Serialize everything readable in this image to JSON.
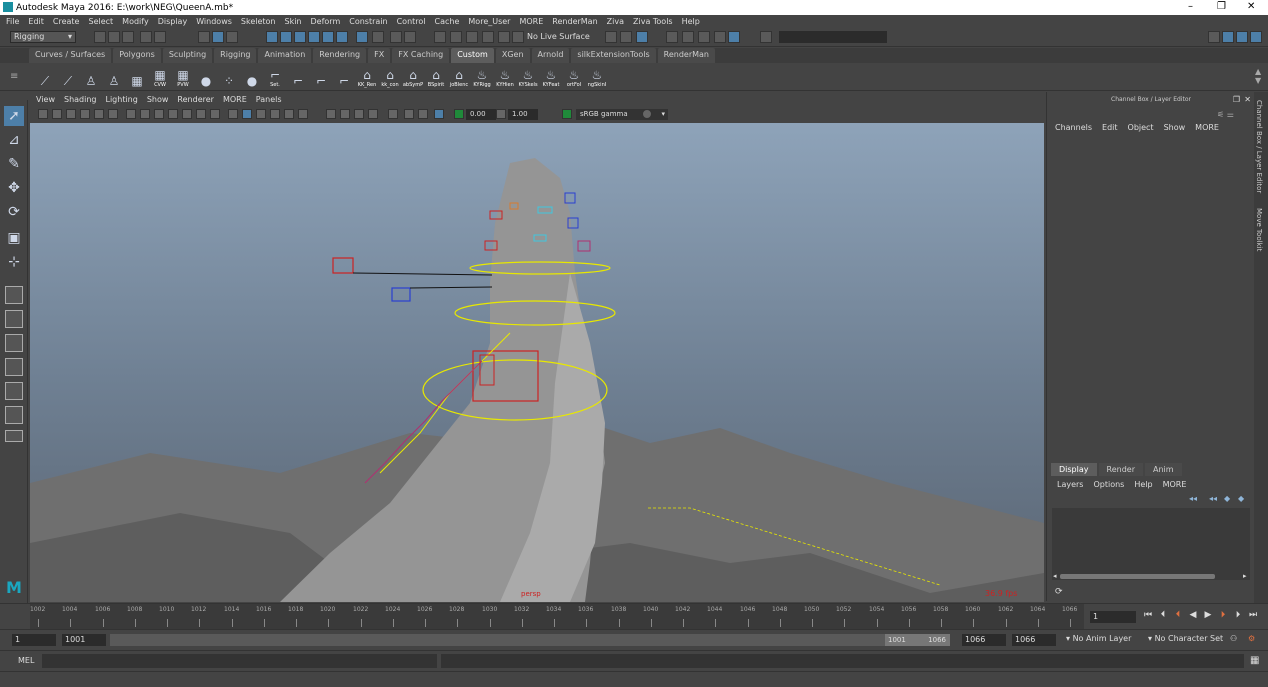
{
  "app": {
    "title": "Autodesk Maya 2016: E:\\work\\NEG\\QueenA.mb*"
  },
  "menu": [
    "File",
    "Edit",
    "Create",
    "Select",
    "Modify",
    "Display",
    "Windows",
    "Skeleton",
    "Skin",
    "Deform",
    "Constrain",
    "Control",
    "Cache",
    "More_User",
    "MORE",
    "RenderMan",
    "Ziva",
    "Ziva Tools",
    "Help"
  ],
  "status": {
    "mode": "Rigging",
    "live_surface": "No Live Surface"
  },
  "shelf_tabs": [
    "Curves / Surfaces",
    "Polygons",
    "Sculpting",
    "Rigging",
    "Animation",
    "Rendering",
    "FX",
    "FX Caching",
    "Custom",
    "XGen",
    "Arnold",
    "silkExtensionTools",
    "RenderMan"
  ],
  "shelf_active": "Custom",
  "shelf_buttons": [
    {
      "icon": "curve-icon",
      "label": ""
    },
    {
      "icon": "curve-icon",
      "label": ""
    },
    {
      "icon": "figure-icon",
      "label": ""
    },
    {
      "icon": "figure-icon",
      "label": ""
    },
    {
      "icon": "grid-icon",
      "label": ""
    },
    {
      "icon": "grid-icon",
      "label": "CVW"
    },
    {
      "icon": "grid-icon",
      "label": "PVW"
    },
    {
      "icon": "sphere-icon",
      "label": ""
    },
    {
      "icon": "dots-icon",
      "label": ""
    },
    {
      "icon": "sphere-icon",
      "label": ""
    },
    {
      "icon": "joint-icon",
      "label": "Set."
    },
    {
      "icon": "joint-icon",
      "label": ""
    },
    {
      "icon": "joint-icon",
      "label": ""
    },
    {
      "icon": "joint-icon",
      "label": ""
    },
    {
      "icon": "house-icon",
      "label": "KK_Ren"
    },
    {
      "icon": "house-icon",
      "label": "kk_con"
    },
    {
      "icon": "house-icon",
      "label": "abSymP"
    },
    {
      "icon": "house-icon",
      "label": "BSpirit"
    },
    {
      "icon": "house-icon",
      "label": "joBlenc"
    },
    {
      "icon": "cup-icon",
      "label": "KYRigg"
    },
    {
      "icon": "cup-icon",
      "label": "KYHien"
    },
    {
      "icon": "cup-icon",
      "label": "KYSkels"
    },
    {
      "icon": "cup-icon",
      "label": "KYFeat"
    },
    {
      "icon": "cup-icon",
      "label": "ortFol"
    },
    {
      "icon": "cup-icon",
      "label": "ngSkinI"
    }
  ],
  "panel_menu": [
    "View",
    "Shading",
    "Lighting",
    "Show",
    "Renderer",
    "MORE",
    "Panels"
  ],
  "panel_toolbar": {
    "gamma_value": "0.00",
    "exposure_value": "1.00",
    "color_space": "sRGB gamma"
  },
  "viewport": {
    "camera": "persp",
    "fps": "36.9 fps"
  },
  "channel_box": {
    "title": "Channel Box / Layer Editor",
    "menu": [
      "Channels",
      "Edit",
      "Object",
      "Show",
      "MORE"
    ]
  },
  "side_tabs": [
    "Channel Box / Layer Editor",
    "Move Toolkit"
  ],
  "layer_editor": {
    "tabs": [
      "Display",
      "Render",
      "Anim"
    ],
    "active_tab": "Display",
    "menu": [
      "Layers",
      "Options",
      "Help",
      "MORE"
    ]
  },
  "timeline": {
    "ticks": [
      "1002",
      "1004",
      "1006",
      "1008",
      "1010",
      "1012",
      "1014",
      "1016",
      "1018",
      "1020",
      "1022",
      "1024",
      "1026",
      "1028",
      "1030",
      "1032",
      "1034",
      "1036",
      "1038",
      "1040",
      "1042",
      "1044",
      "1046",
      "1048",
      "1050",
      "1052",
      "1054",
      "1056",
      "1058",
      "1060",
      "1062",
      "1064",
      "1066"
    ],
    "current_frame": "1"
  },
  "range": {
    "start": "1",
    "playback_start": "1001",
    "slider_start": "1001",
    "slider_end": "1066",
    "playback_end": "1066",
    "end": "1066",
    "anim_layer": "No Anim Layer",
    "char_set": "No Character Set"
  },
  "cmdline": {
    "label": "MEL"
  },
  "colors": {
    "accent": "#4d7fa8",
    "ctrl_red": "#cc2222",
    "ctrl_blue": "#2a3fd0",
    "ctrl_yellow": "#e8e800",
    "ctrl_orange": "#d87a30",
    "ctrl_cyan": "#40c8e0",
    "ctrl_magenta": "#b03070",
    "fps_red": "#cc2222"
  }
}
